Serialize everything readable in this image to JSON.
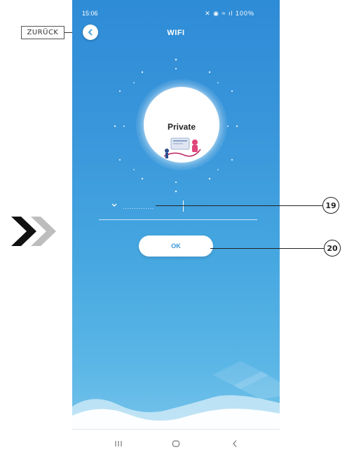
{
  "annotation": {
    "back_label": "ZURÜCK",
    "callouts": [
      "19",
      "20"
    ]
  },
  "status_bar": {
    "time": "15:06",
    "battery": "100%"
  },
  "header": {
    "title": "WIFI",
    "back_icon": "chevron-left-icon"
  },
  "network": {
    "name": "Private"
  },
  "password": {
    "mask": "··············"
  },
  "actions": {
    "ok_label": "OK"
  },
  "nav_bar": {
    "recents_icon": "recents-icon",
    "home_icon": "home-icon",
    "back_icon": "back-icon"
  },
  "colors": {
    "accent": "#3a97db",
    "background_top": "#2e8bd6",
    "background_bottom": "#80c9ec"
  }
}
